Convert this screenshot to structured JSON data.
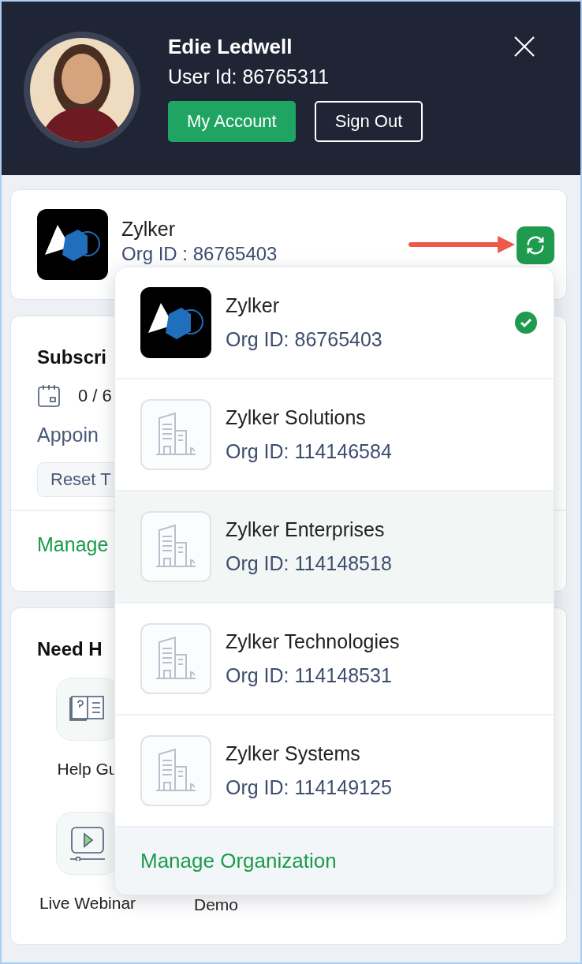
{
  "profile": {
    "name": "Edie Ledwell",
    "user_id": "User Id: 86765311",
    "buttons": [
      {
        "label": "My Account",
        "kind": "primary"
      },
      {
        "label": "Sign Out",
        "kind": "outline"
      }
    ]
  },
  "current_org": {
    "name": "Zylker",
    "org_id": "Org ID : 86765403"
  },
  "subscription": {
    "title": "Subscri",
    "usage": "0 / 6",
    "label": "Appoin",
    "reset": "Reset T",
    "manage": "Manage"
  },
  "help": {
    "title": "Need H",
    "tiles": [
      {
        "label": "Help Gu",
        "kind": "guide"
      },
      {
        "label": "Live Webinar",
        "kind": "webinar"
      }
    ],
    "extra_label": "Demo"
  },
  "org_menu": {
    "items": [
      {
        "name": "Zylker",
        "org_id": "Org ID: 86765403",
        "kind": "brand",
        "selected": true,
        "hovered": false
      },
      {
        "name": "Zylker Solutions",
        "org_id": "Org ID: 114146584",
        "kind": "building",
        "selected": false,
        "hovered": false
      },
      {
        "name": "Zylker Enterprises",
        "org_id": "Org ID: 114148518",
        "kind": "building",
        "selected": false,
        "hovered": true
      },
      {
        "name": "Zylker Technologies",
        "org_id": "Org ID: 114148531",
        "kind": "building",
        "selected": false,
        "hovered": false
      },
      {
        "name": "Zylker Systems",
        "org_id": "Org ID: 114149125",
        "kind": "building",
        "selected": false,
        "hovered": false
      }
    ],
    "footer": "Manage Organization"
  }
}
